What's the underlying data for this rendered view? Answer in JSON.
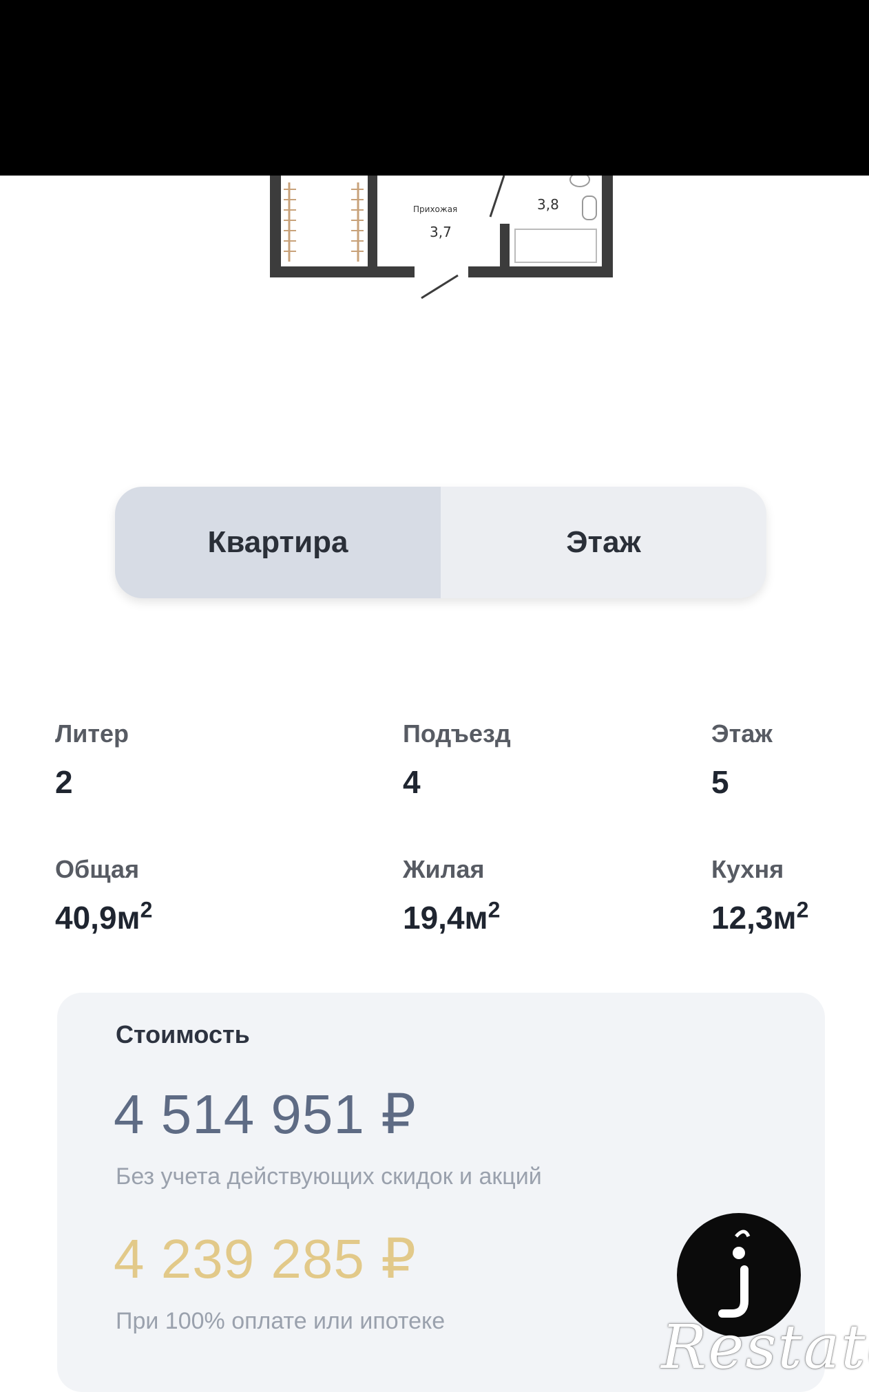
{
  "plan": {
    "room_name": "Прихожая",
    "room_area": "3,7",
    "bath_area": "3,8"
  },
  "tabs": [
    {
      "label": "Квартира",
      "active": true
    },
    {
      "label": "Этаж",
      "active": false
    }
  ],
  "specs": {
    "liter": {
      "label": "Литер",
      "value": "2"
    },
    "entrance": {
      "label": "Подъезд",
      "value": "4"
    },
    "floor": {
      "label": "Этаж",
      "value": "5"
    },
    "total": {
      "label": "Общая",
      "value": "40,9м",
      "unit_sup": "2"
    },
    "living": {
      "label": "Жилая",
      "value": "19,4м",
      "unit_sup": "2"
    },
    "kitchen": {
      "label": "Кухня",
      "value": "12,3м",
      "unit_sup": "2"
    }
  },
  "price": {
    "label": "Стоимость",
    "full": "4 514 951 ₽",
    "full_note": "Без учета действующих скидок и акций",
    "discounted": "4 239 285 ₽",
    "discounted_note": "При 100% оплате или ипотеке"
  },
  "chat_button": {
    "icon": "chat-logo-icon"
  },
  "watermark": "Restate",
  "colors": {
    "topbar": "#000000",
    "active_tab": "#d7dce5",
    "inactive_tab": "#eceef2",
    "price_full": "#5e6b84",
    "price_discounted": "#e2c989",
    "card_bg": "#f2f4f7"
  }
}
